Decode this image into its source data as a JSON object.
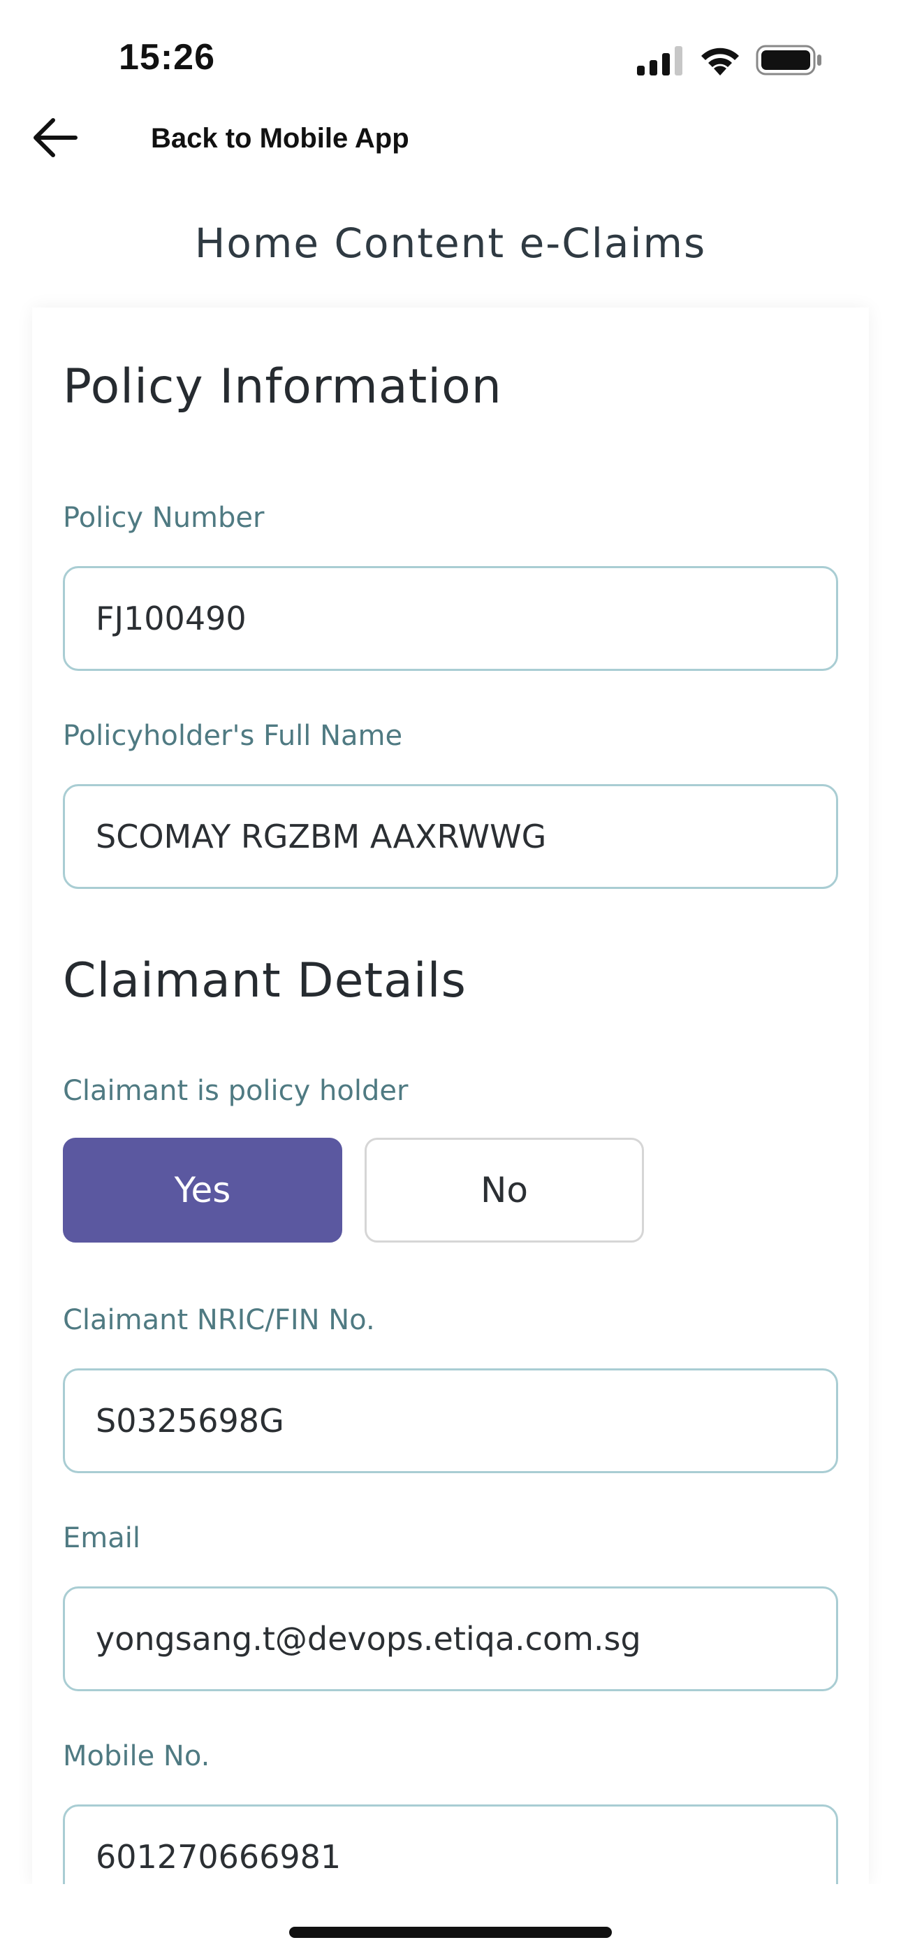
{
  "status_bar": {
    "time": "15:26",
    "icons": [
      "signal-icon",
      "wifi-icon",
      "battery-icon"
    ]
  },
  "nav": {
    "back_icon": "arrow-left-icon",
    "back_label": "Back to Mobile App"
  },
  "page_title": "Home Content e-Claims",
  "policy_information": {
    "heading": "Policy Information",
    "policy_number": {
      "label": "Policy Number",
      "value": "FJ100490"
    },
    "full_name": {
      "label": "Policyholder's Full Name",
      "value": "SCOMAY RGZBM AAXRWWG"
    }
  },
  "claimant_details": {
    "heading": "Claimant Details",
    "is_policy_holder": {
      "label": "Claimant is policy holder",
      "yes_label": "Yes",
      "no_label": "No",
      "selected": "Yes"
    },
    "nric": {
      "label": "Claimant NRIC/FIN No.",
      "value": "S0325698G"
    },
    "email": {
      "label": "Email",
      "value": "yongsang.t@devops.etiqa.com.sg"
    },
    "mobile": {
      "label": "Mobile No.",
      "value": "601270666981"
    }
  },
  "colors": {
    "accent": "#5b58a0",
    "label": "#4f7a82",
    "input_border": "#a9cdd3"
  }
}
